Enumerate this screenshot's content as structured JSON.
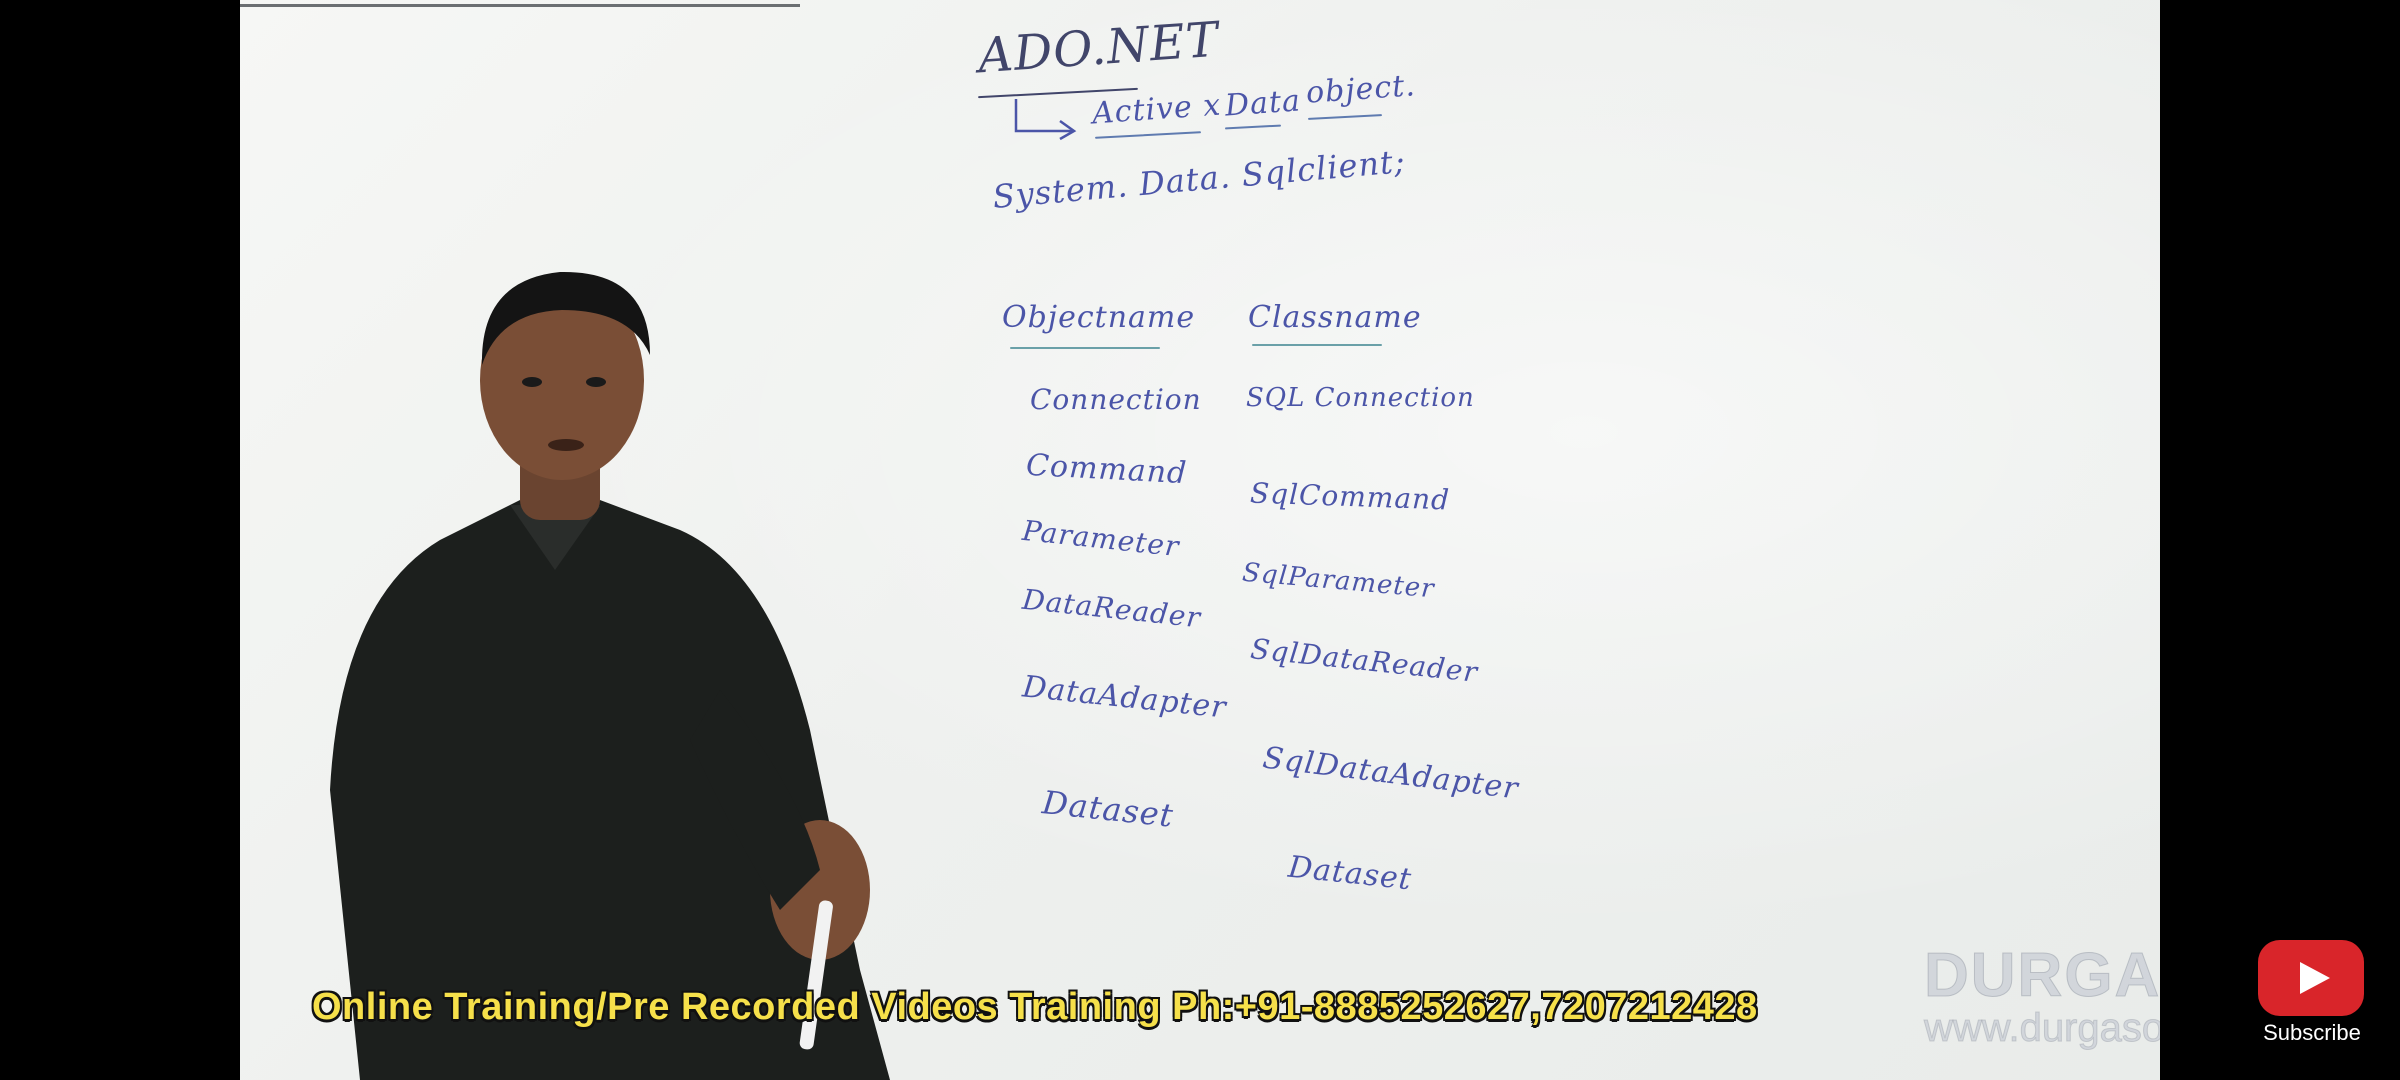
{
  "whiteboard": {
    "title": "ADO.NET",
    "expansion": {
      "word1": "Active x",
      "word2": "Data",
      "word3": "object."
    },
    "namespace": "System. Data. Sqlclient;",
    "columns": {
      "left_header": "Objectname",
      "right_header": "Classname"
    },
    "left_items": [
      "Connection",
      "Command",
      "Parameter",
      "DataReader",
      "DataAdapter",
      "Dataset"
    ],
    "right_items": [
      "SQL Connection",
      "SqlCommand",
      "SqlParameter",
      "SqlDataReader",
      "SqlDataAdapter",
      "Dataset"
    ]
  },
  "caption": "Online Training/Pre Recorded Videos Training Ph:+91-8885252627,7207212428",
  "watermark": {
    "brand": "DURGASOFT",
    "url": "www.durgasoft.com"
  },
  "subscribe": {
    "label": "Subscribe",
    "icon": "youtube-play-icon"
  },
  "colors": {
    "marker_blue": "#4b55a8",
    "caption_yellow": "#f6e04a",
    "subscribe_red": "#d9252a"
  }
}
